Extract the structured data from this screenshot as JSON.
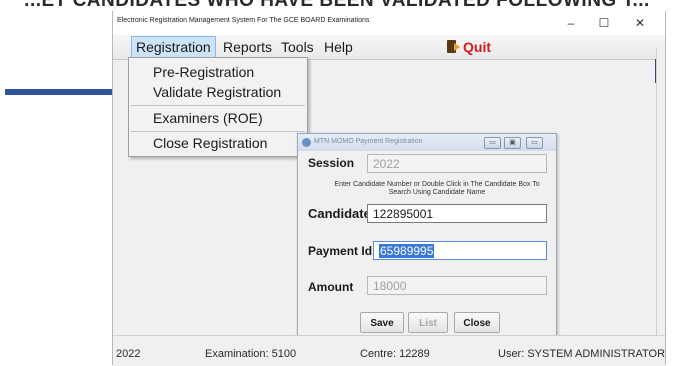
{
  "banner": {
    "text": "...ET CANDIDATES WHO HAVE BEEN VALIDATED FOLLOWING T..."
  },
  "window": {
    "title": "Electronic Registration Management System For The GCE BOARD Examinations",
    "controls": {
      "minimize": "–",
      "maximize": "☐",
      "close": "✕"
    }
  },
  "menubar": {
    "items": [
      {
        "label": "Registration"
      },
      {
        "label": "Reports"
      },
      {
        "label": "Tools"
      },
      {
        "label": "Help"
      }
    ],
    "quit_label": "Quit"
  },
  "dropdown": {
    "items": [
      {
        "label": "Pre-Registration"
      },
      {
        "label": "Validate Registration"
      },
      {
        "label": "Examiners (ROE)"
      },
      {
        "label": "Close Registration"
      }
    ]
  },
  "dialog": {
    "title": "MTN MOMO Payment Registration",
    "session_label": "Session",
    "session_value": "2022",
    "hint": "Enter Candidate Number or Double Click in The Candidate Box To Search Using Candidate Name",
    "candidate_label": "Candidate",
    "candidate_value": "122895001",
    "payment_label": "Payment Id",
    "payment_value": "65989995",
    "amount_label": "Amount",
    "amount_value": "18000",
    "buttons": {
      "save": "Save",
      "list": "List",
      "close": "Close"
    }
  },
  "statusbar": {
    "year": "2022",
    "examination": "Examination: 5100",
    "centre": "Centre: 12289",
    "user": "User: SYSTEM ADMINISTRATOR"
  },
  "colors": {
    "arrow": "#2f5597",
    "quit": "#d21a1a",
    "selection": "#3a78d8"
  }
}
